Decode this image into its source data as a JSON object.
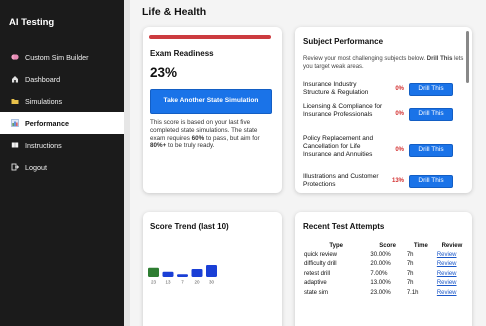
{
  "app": {
    "title": "AI Testing"
  },
  "sidebar": {
    "items": [
      {
        "label": "Custom Sim Builder",
        "icon": "brain-icon"
      },
      {
        "label": "Dashboard",
        "icon": "home-icon"
      },
      {
        "label": "Simulations",
        "icon": "folder-icon"
      },
      {
        "label": "Performance",
        "icon": "bar-chart-icon",
        "active": true
      },
      {
        "label": "Instructions",
        "icon": "book-icon"
      },
      {
        "label": "Logout",
        "icon": "logout-icon"
      }
    ]
  },
  "main": {
    "section_title": "Life & Health"
  },
  "readiness": {
    "title": "Exam Readiness",
    "percent": "23%",
    "button_label": "Take Another State Simulation",
    "text_1": "This score is based on your last five completed state simulations. The state exam requires ",
    "text_pass": "60%",
    "text_2": " to pass, but aim for ",
    "text_goal": "80%+",
    "text_3": " to be truly ready.",
    "accent_color": "#cc3b3f"
  },
  "subject_performance": {
    "title": "Subject Performance",
    "intro_1": "Review your most challenging subjects below. ",
    "intro_bold": "Drill This",
    "intro_2": " lets you target weak areas.",
    "rows": [
      {
        "name": "Insurance Industry Structure & Regulation",
        "percent": "0%",
        "button": "Drill This"
      },
      {
        "name": "Licensing & Compliance for Insurance Professionals",
        "percent": "0%",
        "button": "Drill This"
      },
      {
        "name": "Policy Replacement and Cancellation for Life Insurance and Annuities",
        "percent": "0%",
        "button": "Drill This"
      },
      {
        "name": "Illustrations and Customer Protections",
        "percent": "13%",
        "button": "Drill This"
      }
    ]
  },
  "trend": {
    "title": "Score Trend (last 10)"
  },
  "chart_data": {
    "type": "bar",
    "categories": [
      "23",
      "13",
      "7",
      "20",
      "30"
    ],
    "values": [
      23,
      13,
      7,
      20,
      30
    ],
    "colors": [
      "#2e7d32",
      "#1a3fd6",
      "#1a3fd6",
      "#1a3fd6",
      "#1a3fd6"
    ],
    "title": "Score Trend (last 10)",
    "xlabel": "",
    "ylabel": ""
  },
  "recent": {
    "title": "Recent Test Attempts",
    "columns": [
      "Type",
      "Score",
      "Time",
      "Review"
    ],
    "rows": [
      {
        "type": "quick review",
        "score": "30.00%",
        "time": "7h",
        "review": "Review"
      },
      {
        "type": "difficulty drill",
        "score": "20.00%",
        "time": "7h",
        "review": "Review"
      },
      {
        "type": "retest drill",
        "score": "7.00%",
        "time": "7h",
        "review": "Review"
      },
      {
        "type": "adaptive",
        "score": "13.00%",
        "time": "7h",
        "review": "Review"
      },
      {
        "type": "state sim",
        "score": "23.00%",
        "time": "7.1h",
        "review": "Review"
      }
    ]
  }
}
